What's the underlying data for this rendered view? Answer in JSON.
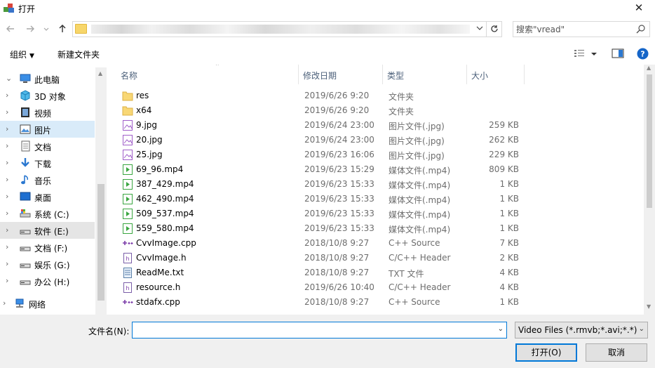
{
  "window": {
    "title": "打开",
    "close_glyph": "✕"
  },
  "address": {
    "back_icon": "back-arrow-icon",
    "forward_icon": "forward-arrow-icon",
    "up_icon": "up-arrow-icon",
    "search_placeholder": "搜索\"vread\""
  },
  "toolbar": {
    "organize": "组织",
    "new_folder": "新建文件夹"
  },
  "nav": {
    "items": [
      {
        "label": "此电脑",
        "icon": "computer-icon"
      },
      {
        "label": "3D 对象",
        "icon": "3d-objects-icon"
      },
      {
        "label": "视频",
        "icon": "video-icon"
      },
      {
        "label": "图片",
        "icon": "pictures-icon"
      },
      {
        "label": "文档",
        "icon": "documents-icon"
      },
      {
        "label": "下载",
        "icon": "download-icon"
      },
      {
        "label": "音乐",
        "icon": "music-icon"
      },
      {
        "label": "桌面",
        "icon": "desktop-icon"
      },
      {
        "label": "系统 (C:)",
        "icon": "system-drive-icon"
      },
      {
        "label": "软件 (E:)",
        "icon": "drive-icon"
      },
      {
        "label": "文档 (F:)",
        "icon": "drive-icon"
      },
      {
        "label": "娱乐 (G:)",
        "icon": "drive-icon"
      },
      {
        "label": "办公 (H:)",
        "icon": "drive-icon"
      },
      {
        "label": "网络",
        "icon": "network-icon"
      }
    ]
  },
  "columns": {
    "name": "名称",
    "date": "修改日期",
    "type": "类型",
    "size": "大小"
  },
  "files": [
    {
      "name": "res",
      "date": "2019/6/26 9:20",
      "type": "文件夹",
      "size": "",
      "kind": "folder"
    },
    {
      "name": "x64",
      "date": "2019/6/26 9:20",
      "type": "文件夹",
      "size": "",
      "kind": "folder"
    },
    {
      "name": "9.jpg",
      "date": "2019/6/24 23:00",
      "type": "图片文件(.jpg)",
      "size": "259 KB",
      "kind": "image"
    },
    {
      "name": "20.jpg",
      "date": "2019/6/24 23:00",
      "type": "图片文件(.jpg)",
      "size": "262 KB",
      "kind": "image"
    },
    {
      "name": "25.jpg",
      "date": "2019/6/23 16:06",
      "type": "图片文件(.jpg)",
      "size": "229 KB",
      "kind": "image"
    },
    {
      "name": "69_96.mp4",
      "date": "2019/6/23 15:29",
      "type": "媒体文件(.mp4)",
      "size": "809 KB",
      "kind": "video"
    },
    {
      "name": "387_429.mp4",
      "date": "2019/6/23 15:33",
      "type": "媒体文件(.mp4)",
      "size": "1 KB",
      "kind": "video"
    },
    {
      "name": "462_490.mp4",
      "date": "2019/6/23 15:33",
      "type": "媒体文件(.mp4)",
      "size": "1 KB",
      "kind": "video"
    },
    {
      "name": "509_537.mp4",
      "date": "2019/6/23 15:33",
      "type": "媒体文件(.mp4)",
      "size": "1 KB",
      "kind": "video"
    },
    {
      "name": "559_580.mp4",
      "date": "2019/6/23 15:33",
      "type": "媒体文件(.mp4)",
      "size": "1 KB",
      "kind": "video"
    },
    {
      "name": "CvvImage.cpp",
      "date": "2018/10/8 9:27",
      "type": "C++ Source",
      "size": "7 KB",
      "kind": "cpp"
    },
    {
      "name": "CvvImage.h",
      "date": "2018/10/8 9:27",
      "type": "C/C++ Header",
      "size": "2 KB",
      "kind": "header"
    },
    {
      "name": "ReadMe.txt",
      "date": "2018/10/8 9:27",
      "type": "TXT 文件",
      "size": "4 KB",
      "kind": "text"
    },
    {
      "name": "resource.h",
      "date": "2019/6/26 10:40",
      "type": "C/C++ Header",
      "size": "4 KB",
      "kind": "header"
    },
    {
      "name": "stdafx.cpp",
      "date": "2018/10/8 9:27",
      "type": "C++ Source",
      "size": "1 KB",
      "kind": "cpp"
    }
  ],
  "bottom": {
    "filename_label": "文件名(N):",
    "filename_value": "",
    "filter": "Video Files (*.rmvb;*.avi;*.*)",
    "open": "打开(O)",
    "cancel": "取消"
  }
}
